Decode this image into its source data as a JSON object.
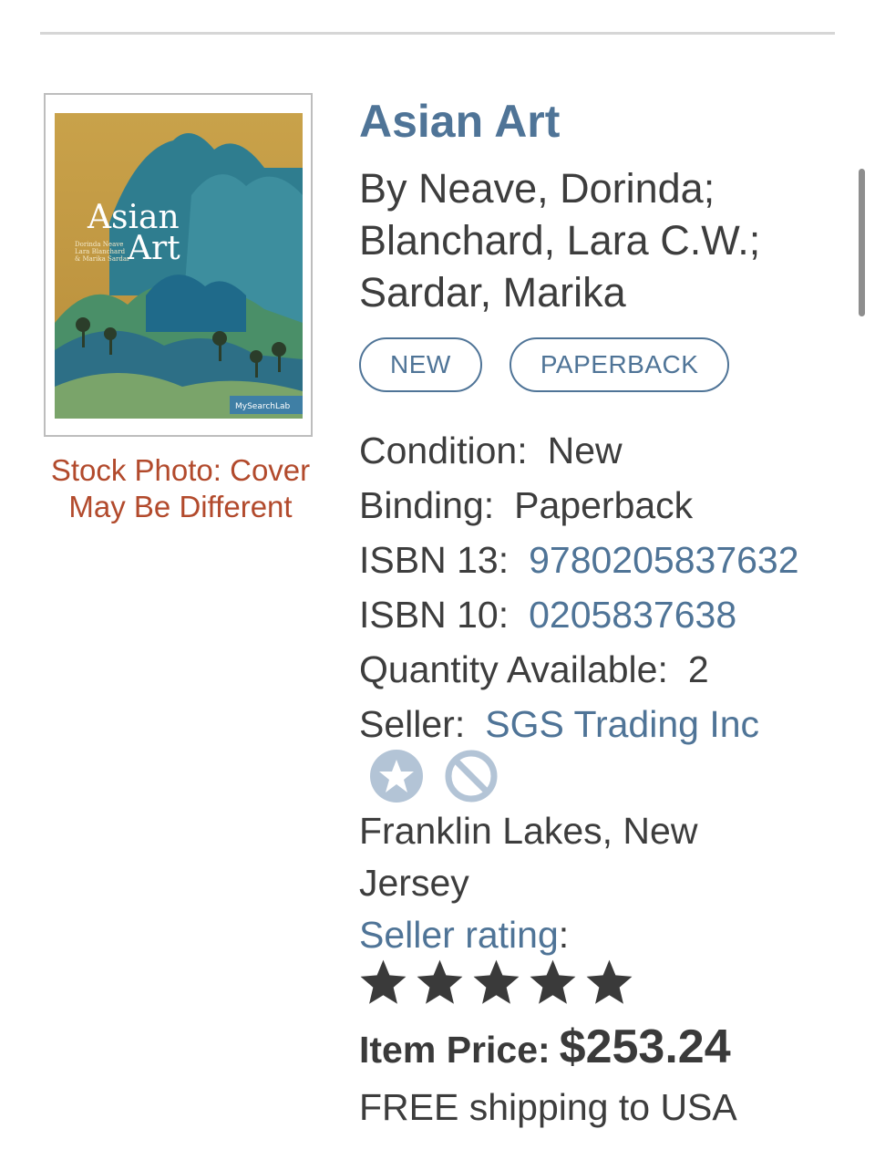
{
  "listing": {
    "title": "Asian Art",
    "authors": "By Neave, Dorinda; Blanchard, Lara C.W.; Sardar, Marika",
    "badges": [
      "NEW",
      "PAPERBACK"
    ],
    "stock_photo_note": "Stock Photo: Cover May Be Different",
    "cover": {
      "title_line1": "Asian",
      "title_line2": "Art",
      "authors_small": [
        "Dorinda Neave",
        "Lara Blanchard",
        "& Marika Sardar"
      ],
      "publisher_mark": "MySearchLab"
    },
    "details": {
      "condition_label": "Condition:",
      "condition_value": "New",
      "binding_label": "Binding:",
      "binding_value": "Paperback",
      "isbn13_label": "ISBN 13:",
      "isbn13_value": "9780205837632",
      "isbn10_label": "ISBN 10:",
      "isbn10_value": "0205837638",
      "quantity_label": "Quantity Available:",
      "quantity_value": "2",
      "seller_label": "Seller:",
      "seller_value": "SGS Trading Inc"
    },
    "seller_icons": [
      "star-badge-icon",
      "blocked-icon"
    ],
    "location": "Franklin Lakes, New Jersey",
    "rating": {
      "label": "Seller rating",
      "suffix": ":",
      "stars": 5,
      "max_stars": 5
    },
    "price": {
      "label": "Item Price:",
      "value": "$253.24"
    },
    "shipping": "FREE shipping to USA"
  },
  "colors": {
    "link": "#4f7497",
    "text": "#3d3d3d",
    "stock_note": "#b24a2c",
    "icon_muted": "#b3c4d6"
  }
}
